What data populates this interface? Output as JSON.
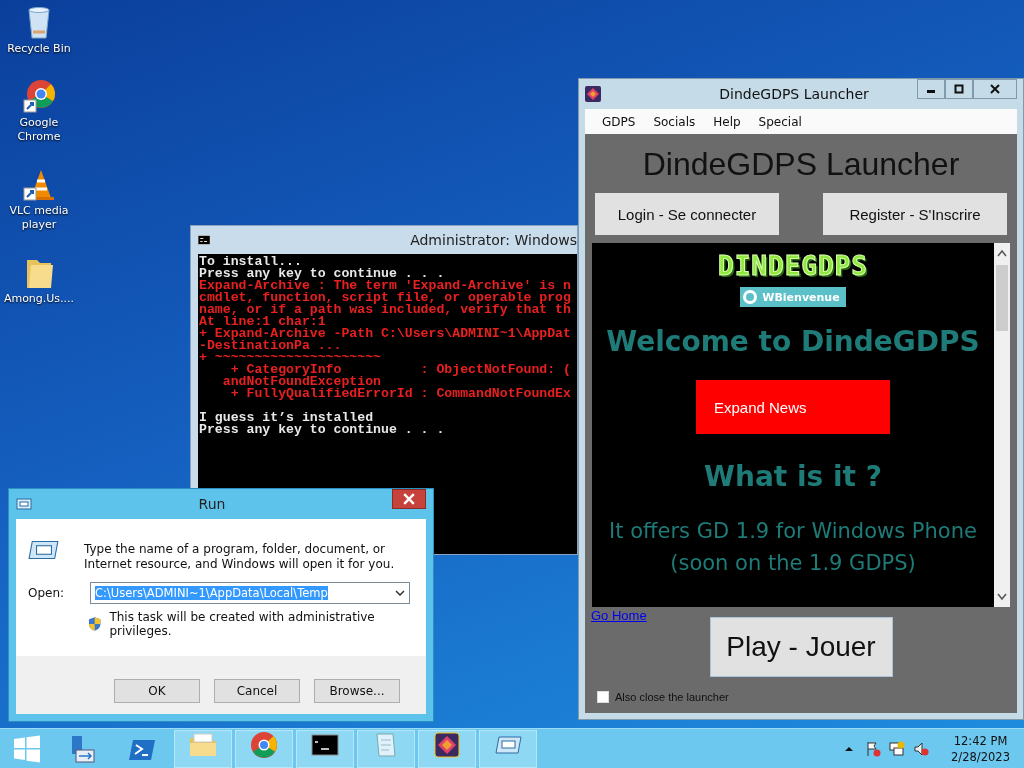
{
  "desktop_icons": [
    {
      "kind": "recycle",
      "label": "Recycle Bin"
    },
    {
      "kind": "chrome",
      "label": "Google Chrome"
    },
    {
      "kind": "vlc",
      "label": "VLC media player"
    },
    {
      "kind": "folder",
      "label": "Among.Us...."
    }
  ],
  "console": {
    "title": "Administrator: Windows",
    "lines": [
      {
        "kind": "output",
        "text": "To install..."
      },
      {
        "kind": "output",
        "text": "Press any key to continue . . ."
      },
      {
        "kind": "error",
        "text": "Expand-Archive : The term 'Expand-Archive' is n"
      },
      {
        "kind": "error",
        "text": "cmdlet, function, script file, or operable prog"
      },
      {
        "kind": "error",
        "text": "name, or if a path was included, verify that th"
      },
      {
        "kind": "error",
        "text": "At line:1 char:1"
      },
      {
        "kind": "error",
        "text": "+ Expand-Archive -Path C:\\Users\\ADMINI~1\\AppDat"
      },
      {
        "kind": "error",
        "text": "-DestinationPa ..."
      },
      {
        "kind": "error",
        "text": "+ ~~~~~~~~~~~~~~~~~~~~~"
      },
      {
        "kind": "error",
        "text": "    + CategoryInfo          : ObjectNotFound: ("
      },
      {
        "kind": "error",
        "text": "   andNotFoundException"
      },
      {
        "kind": "error",
        "text": "    + FullyQualifiedErrorId : CommandNotFoundEx"
      }
    ],
    "after_lines": [
      {
        "kind": "output",
        "text": "I guess it’s installed"
      },
      {
        "kind": "output",
        "text": "Press any key to continue . . ."
      }
    ]
  },
  "run_dialog": {
    "title": "Run",
    "message": "Type the name of a program, folder, document, or Internet resource, and Windows will open it for you.",
    "open_label": "Open:",
    "open_value": "C:\\Users\\ADMINI~1\\AppData\\Local\\Temp",
    "value_selected": true,
    "admin_note": "This task will be created with administrative privileges.",
    "buttons": [
      "OK",
      "Cancel",
      "Browse..."
    ]
  },
  "launcher": {
    "title": "DindeGDPS Launcher",
    "menu": [
      "GDPS",
      "Socials",
      "Help",
      "Special"
    ],
    "heading": "DindeGDPS Launcher",
    "login": "Login - Se connecter",
    "register": "Register - S'Inscrire",
    "web": {
      "logo": "DINDEGDPS",
      "badge": "WBienvenue",
      "welcome": "Welcome to DindeGDPS",
      "expand": "Expand News",
      "what": "What is it ?",
      "offer": "It offers GD 1.9 for Windows Phone (soon on the 1.9 GDPS)"
    },
    "go_home": "Go Home",
    "play": "Play - Jouer",
    "close_option": {
      "label": "Also close the launcher",
      "checked": false
    }
  },
  "taskbar": {
    "items": [
      {
        "kind": "server",
        "running": false
      },
      {
        "kind": "powershell",
        "running": false
      },
      {
        "kind": "explorer",
        "running": true
      },
      {
        "kind": "chrome",
        "running": true
      },
      {
        "kind": "cmd",
        "running": true
      },
      {
        "kind": "notepad",
        "running": true
      },
      {
        "kind": "game",
        "running": true
      },
      {
        "kind": "run",
        "running": true
      }
    ],
    "time": "12:42 PM",
    "date": "2/28/2023"
  }
}
